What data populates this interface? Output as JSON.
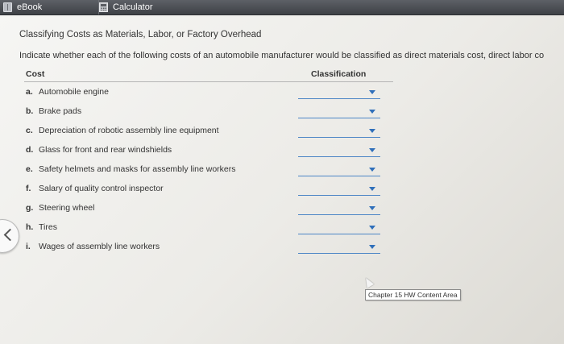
{
  "tabs": [
    {
      "label": "eBook",
      "icon": "book-icon"
    },
    {
      "label": "Calculator",
      "icon": "calculator-icon"
    }
  ],
  "heading": "Classifying Costs as Materials, Labor, or Factory Overhead",
  "instructions": "Indicate whether each of the following costs of an automobile manufacturer would be classified as direct materials cost, direct labor co",
  "table": {
    "cost_header": "Cost",
    "classification_header": "Classification",
    "rows": [
      {
        "letter": "a.",
        "label": "Automobile engine",
        "selected": ""
      },
      {
        "letter": "b.",
        "label": "Brake pads",
        "selected": ""
      },
      {
        "letter": "c.",
        "label": "Depreciation of robotic assembly line equipment",
        "selected": ""
      },
      {
        "letter": "d.",
        "label": "Glass for front and rear windshields",
        "selected": ""
      },
      {
        "letter": "e.",
        "label": "Safety helmets and masks for assembly line workers",
        "selected": ""
      },
      {
        "letter": "f.",
        "label": "Salary of quality control inspector",
        "selected": ""
      },
      {
        "letter": "g.",
        "label": "Steering wheel",
        "selected": ""
      },
      {
        "letter": "h.",
        "label": "Tires",
        "selected": ""
      },
      {
        "letter": "i.",
        "label": "Wages of assembly line workers",
        "selected": ""
      }
    ]
  },
  "tooltip": "Chapter 15 HW Content Area",
  "colors": {
    "dropdown_underline": "#4d86c6",
    "caret": "#2f6fba",
    "topbar": "#4a4d52"
  }
}
